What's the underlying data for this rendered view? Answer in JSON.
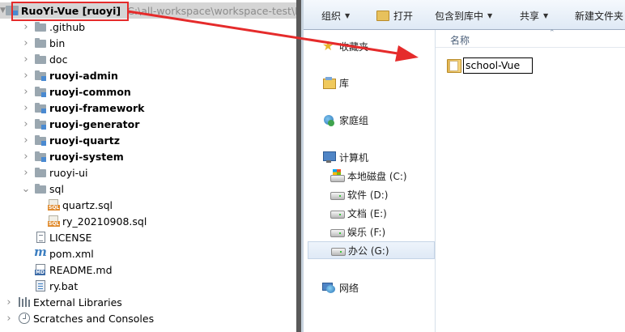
{
  "ide": {
    "project": {
      "name": "RuoYi-Vue [ruoyi]",
      "path": "C:\\all-workspace\\workspace-test\\Ru"
    },
    "tree": [
      {
        "label": ".github",
        "bold": false,
        "icon": "folder",
        "arrow": "right"
      },
      {
        "label": "bin",
        "bold": false,
        "icon": "folder",
        "arrow": "right"
      },
      {
        "label": "doc",
        "bold": false,
        "icon": "folder",
        "arrow": "right"
      },
      {
        "label": "ruoyi-admin",
        "bold": true,
        "icon": "module-folder",
        "arrow": "right"
      },
      {
        "label": "ruoyi-common",
        "bold": true,
        "icon": "module-folder",
        "arrow": "right"
      },
      {
        "label": "ruoyi-framework",
        "bold": true,
        "icon": "module-folder",
        "arrow": "right"
      },
      {
        "label": "ruoyi-generator",
        "bold": true,
        "icon": "module-folder",
        "arrow": "right"
      },
      {
        "label": "ruoyi-quartz",
        "bold": true,
        "icon": "module-folder",
        "arrow": "right"
      },
      {
        "label": "ruoyi-system",
        "bold": true,
        "icon": "module-folder",
        "arrow": "right"
      },
      {
        "label": "ruoyi-ui",
        "bold": false,
        "icon": "folder",
        "arrow": "right"
      },
      {
        "label": "sql",
        "bold": false,
        "icon": "folder",
        "arrow": "down"
      },
      {
        "label": "quartz.sql",
        "bold": false,
        "icon": "sql-file",
        "arrow": "none"
      },
      {
        "label": "ry_20210908.sql",
        "bold": false,
        "icon": "sql-file",
        "arrow": "none"
      },
      {
        "label": "LICENSE",
        "bold": false,
        "icon": "text-file",
        "arrow": "none"
      },
      {
        "label": "pom.xml",
        "bold": false,
        "icon": "maven-file",
        "arrow": "none"
      },
      {
        "label": "README.md",
        "bold": false,
        "icon": "markdown-file",
        "arrow": "none"
      },
      {
        "label": "ry.bat",
        "bold": false,
        "icon": "batch-file",
        "arrow": "none"
      }
    ],
    "bottom": [
      {
        "label": "External Libraries",
        "icon": "libraries"
      },
      {
        "label": "Scratches and Consoles",
        "icon": "scratches"
      }
    ],
    "icon_labels": {
      "sql": "SQL",
      "md": "MD"
    }
  },
  "explorer": {
    "toolbar": {
      "organize": "组织",
      "open": "打开",
      "include_library": "包含到库中",
      "share": "共享",
      "new_folder": "新建文件夹"
    },
    "nav": {
      "favorites": "收藏夹",
      "libraries": "库",
      "homegroup": "家庭组",
      "computer": "计算机",
      "drives": [
        {
          "label": "本地磁盘 (C:)",
          "selected": false
        },
        {
          "label": "软件 (D:)",
          "selected": false
        },
        {
          "label": "文档 (E:)",
          "selected": false
        },
        {
          "label": "娱乐 (F:)",
          "selected": false
        },
        {
          "label": "办公 (G:)",
          "selected": true
        }
      ],
      "network": "网络"
    },
    "column_header": "名称",
    "rename_value": "school-Vue"
  },
  "colors": {
    "annotation_red": "#e52b2b",
    "selection_gray": "#d5d5d5",
    "folder_yellow": "#e4b64e"
  }
}
